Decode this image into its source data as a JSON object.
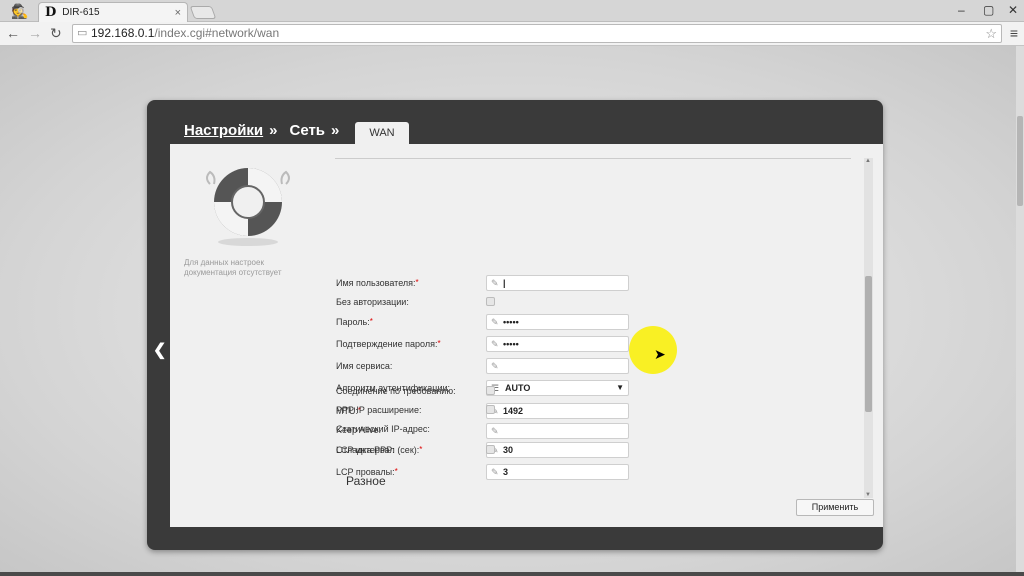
{
  "browser": {
    "tab_title": "DIR-615",
    "favicon_letter": "D",
    "tab_close": "×",
    "url_host": "192.168.0.1",
    "url_path": "/index.cgi#network/wan",
    "window_controls": [
      "–",
      "▢",
      "✕"
    ]
  },
  "breadcrumb": {
    "item1": "Настройки",
    "sep1": "»",
    "item2": "Сеть",
    "sep2": "»",
    "active_tab": "WAN"
  },
  "sidebar": {
    "help_text": "Для данных настроек документация отсутствует"
  },
  "form": {
    "username_label": "Имя пользователя:",
    "username_value": "|",
    "no_auth_label": "Без авторизации:",
    "password_label": "Пароль:",
    "password_value": "•••••",
    "password_confirm_label": "Подтверждение пароля:",
    "password_confirm_value": "•••••",
    "service_name_label": "Имя сервиса:",
    "service_name_value": "",
    "auth_algo_label": "Алгоритм аутентификации:",
    "auth_algo_value": "AUTO",
    "mtu_label": "MTU:",
    "mtu_value": "1492",
    "keep_alive_label": "Keep Alive:",
    "keep_alive_checked": true,
    "lcp_interval_label": "LCP интервал (сек):",
    "lcp_interval_value": "30",
    "lcp_fails_label": "LCP провалы:",
    "lcp_fails_value": "3",
    "on_demand_label": "Соединение по требованию:",
    "ppp_ip_ext_label": "PPP IP расширение:",
    "static_ip_label": "Статический IP-адрес:",
    "static_ip_value": "",
    "ppp_debug_label": "Отладка PPP:",
    "required_mark": "*"
  },
  "section": {
    "misc_title": "Разное"
  },
  "buttons": {
    "apply": "Применить"
  },
  "colors": {
    "panel": "#3a3a3a",
    "content": "#f0f0f0",
    "required": "#dd0000",
    "cursor_highlight": "#faf000"
  }
}
